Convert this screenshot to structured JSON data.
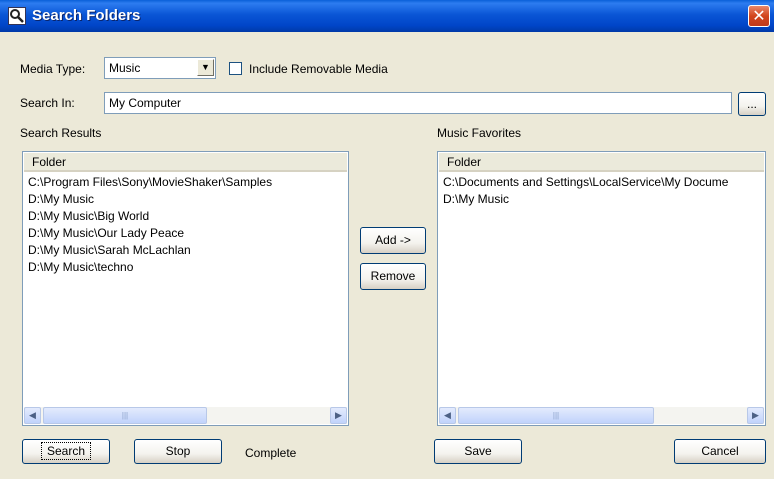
{
  "window": {
    "title": "Search Folders",
    "close_glyph": "✕"
  },
  "media_type": {
    "label": "Media Type:",
    "value": "Music",
    "dropdown_glyph": "▼"
  },
  "include_removable": {
    "label": "Include Removable Media",
    "checked": false
  },
  "search_in": {
    "label": "Search In:",
    "value": "My Computer",
    "browse_label": "..."
  },
  "search_results": {
    "heading": "Search Results",
    "column_header": "Folder",
    "items": [
      "C:\\Program Files\\Sony\\MovieShaker\\Samples",
      "D:\\My Music",
      "D:\\My Music\\Big World",
      "D:\\My Music\\Our Lady Peace",
      "D:\\My Music\\Sarah McLachlan",
      "D:\\My Music\\techno"
    ]
  },
  "favorites": {
    "heading": "Music Favorites",
    "column_header": "Folder",
    "items": [
      "C:\\Documents and Settings\\LocalService\\My Docume",
      "D:\\My Music"
    ]
  },
  "scrollbar": {
    "left_glyph": "◀",
    "right_glyph": "▶",
    "grip_glyph": "|||"
  },
  "buttons": {
    "add": "Add ->",
    "remove": "Remove",
    "search": "Search",
    "stop": "Stop",
    "save": "Save",
    "cancel": "Cancel"
  },
  "status": "Complete",
  "colors": {
    "titlebar": "#0a56d6",
    "dialog_bg": "#ece9d8",
    "close_red": "#d2461d"
  }
}
